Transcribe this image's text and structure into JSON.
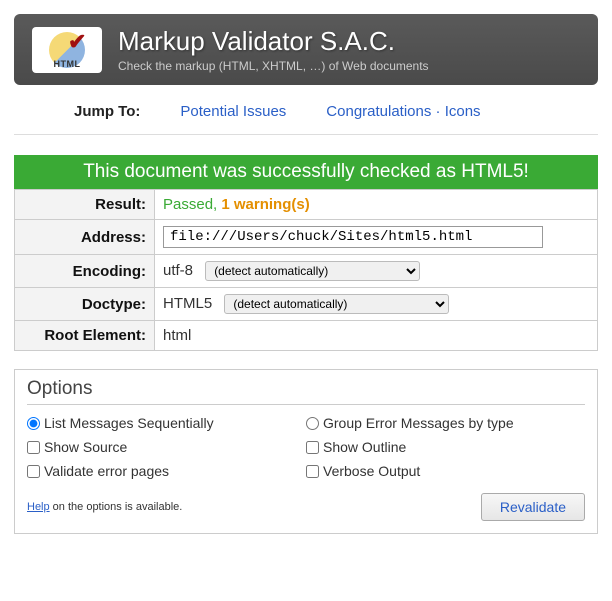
{
  "header": {
    "logo_label": "HTML",
    "title": "Markup Validator S.A.C.",
    "subtitle": "Check the markup (HTML, XHTML, …) of Web documents"
  },
  "jumpnav": {
    "label": "Jump To:",
    "link1": "Potential Issues",
    "link2": "Congratulations · Icons"
  },
  "banner": "This document was successfully checked as HTML5!",
  "rows": {
    "result_label": "Result:",
    "result_passed": "Passed, ",
    "result_warn": "1 warning(s)",
    "address_label": "Address:",
    "address_value": "file:///Users/chuck/Sites/html5.html",
    "encoding_label": "Encoding:",
    "encoding_value": "utf-8",
    "encoding_detect": "(detect automatically)",
    "doctype_label": "Doctype:",
    "doctype_value": "HTML5",
    "doctype_detect": "(detect automatically)",
    "root_label": "Root Element:",
    "root_value": "html"
  },
  "options": {
    "title": "Options",
    "list_seq": "List Messages Sequentially",
    "group_type": "Group Error Messages by type",
    "show_source": "Show Source",
    "show_outline": "Show Outline",
    "validate_err": "Validate error pages",
    "verbose": "Verbose Output",
    "help_link": "Help",
    "help_rest": " on the options is available.",
    "revalidate": "Revalidate"
  }
}
